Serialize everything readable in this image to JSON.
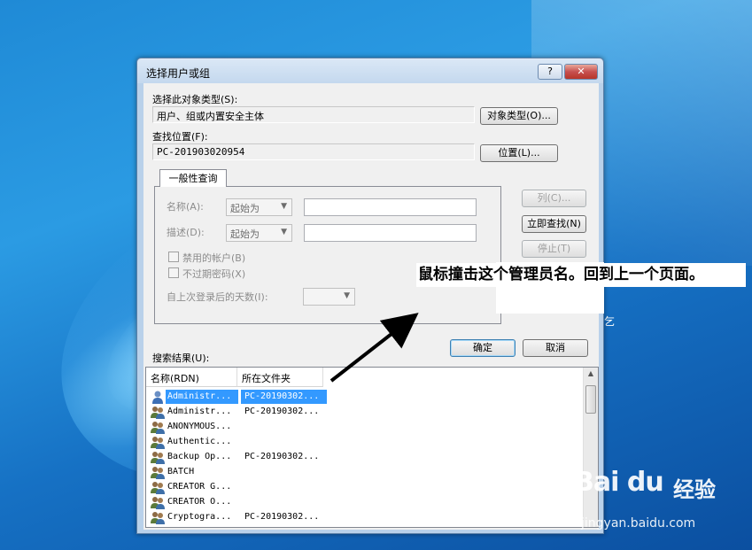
{
  "window": {
    "title": "选择用户或组",
    "help_label": "?",
    "close_label": "✕"
  },
  "object_type": {
    "label": "选择此对象类型(S):",
    "value": "用户、组或内置安全主体",
    "button": "对象类型(O)..."
  },
  "location": {
    "label": "查找位置(F):",
    "value": "PC-201903020954",
    "button": "位置(L)..."
  },
  "query": {
    "tab_label": "一般性查询",
    "name_label": "名称(A):",
    "name_mode": "起始为",
    "desc_label": "描述(D):",
    "desc_mode": "起始为",
    "disabled_accounts": "禁用的帐户(B)",
    "no_expire_pwd": "不过期密码(X)",
    "days_since_login": "自上次登录后的天数(I):"
  },
  "buttons": {
    "columns": "列(C)...",
    "find_now": "立即查找(N)",
    "stop": "停止(T)",
    "ok": "确定",
    "cancel": "取消"
  },
  "results": {
    "label": "搜索结果(U):",
    "columns": [
      "名称(RDN)",
      "所在文件夹"
    ],
    "rows": [
      {
        "name": "Administr...",
        "folder": "PC-20190302...",
        "icon": "user-icon",
        "selected": true
      },
      {
        "name": "Administr...",
        "folder": "PC-20190302...",
        "icon": "group-icon"
      },
      {
        "name": "ANONYMOUS...",
        "folder": "",
        "icon": "group-icon"
      },
      {
        "name": "Authentic...",
        "folder": "",
        "icon": "group-icon"
      },
      {
        "name": "Backup Op...",
        "folder": "PC-20190302...",
        "icon": "group-icon"
      },
      {
        "name": "BATCH",
        "folder": "",
        "icon": "group-icon"
      },
      {
        "name": "CREATOR G...",
        "folder": "",
        "icon": "group-icon"
      },
      {
        "name": "CREATOR O...",
        "folder": "",
        "icon": "group-icon"
      },
      {
        "name": "Cryptogra...",
        "folder": "PC-20190302...",
        "icon": "group-icon"
      }
    ]
  },
  "annotation": {
    "text": "鼠标撞击这个管理员名。回到上一个页面。"
  },
  "desktop": {
    "hint_char": "乞"
  },
  "watermark": {
    "logo": "Bai du",
    "cn": "经验",
    "url": "jingyan.baidu.com"
  },
  "colors": {
    "selection": "#3399ff",
    "title_bar": "#c4d8ee",
    "close_button": "#c75050",
    "desktop": "#1f8ad6"
  }
}
